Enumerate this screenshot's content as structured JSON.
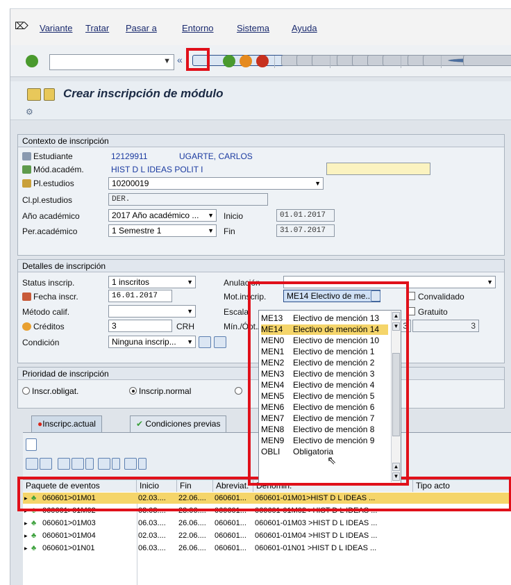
{
  "menu": [
    "Variante",
    "Tratar",
    "Pasar a",
    "Entorno",
    "Sistema",
    "Ayuda"
  ],
  "title": "Crear inscripción de módulo",
  "contexto": {
    "caption": "Contexto de inscripción",
    "estudiante_label": "Estudiante",
    "estudiante_id": "12129911",
    "estudiante_name": "UGARTE, CARLOS",
    "modacadem_label": "Mód.académ.",
    "modacadem_value": "HIST D L IDEAS POLIT I",
    "plestudios_label": "Pl.estudios",
    "plestudios_value": "10200019",
    "clpl_label": "Cl.pl.estudios",
    "clpl_value": "DER.",
    "anio_label": "Año académico",
    "anio_value": "2017 Año académico ...",
    "inicio_label": "Inicio",
    "inicio_value": "01.01.2017",
    "per_label": "Per.académico",
    "per_value": "1 Semestre 1",
    "fin_label": "Fin",
    "fin_value": "31.07.2017"
  },
  "detalles": {
    "caption": "Detalles de inscripción",
    "status_label": "Status inscrip.",
    "status_value": "1 inscritos",
    "anulacion_label": "Anulación",
    "fecha_label": "Fecha inscr.",
    "fecha_value": "16.01.2017",
    "motinscrip_label": "Mot.inscrip.",
    "motinscrip_value": "ME14 Electivo de me...",
    "convalidado_label": "Convalidado",
    "metodo_label": "Método calif.",
    "escala_label": "Escala",
    "gratuito_label": "Gratuito",
    "creditos_label": "Créditos",
    "creditos_value": "3",
    "creditos_unit": "CRH",
    "minopt_label": "Mín./Ópt./Ma",
    "min_value": "3",
    "max_value": "3",
    "condicion_label": "Condición",
    "condicion_value": "Ninguna inscrip..."
  },
  "prioridad": {
    "caption": "Prioridad de inscripción",
    "opt1": "Inscr.obligat.",
    "opt2": "Inscrip.normal"
  },
  "tabs": [
    "Inscripc.actual",
    "Condiciones previas"
  ],
  "dropdown_items": [
    {
      "code": "ME13",
      "text": "Electivo de mención 13",
      "selected": false
    },
    {
      "code": "ME14",
      "text": "Electivo de mención 14",
      "selected": true
    },
    {
      "code": "MEN0",
      "text": "Electivo de mención 10",
      "selected": false
    },
    {
      "code": "MEN1",
      "text": "Electivo de mención 1",
      "selected": false
    },
    {
      "code": "MEN2",
      "text": "Electivo de mención 2",
      "selected": false
    },
    {
      "code": "MEN3",
      "text": "Electivo de mención 3",
      "selected": false
    },
    {
      "code": "MEN4",
      "text": "Electivo de mención 4",
      "selected": false
    },
    {
      "code": "MEN5",
      "text": "Electivo de mención 5",
      "selected": false
    },
    {
      "code": "MEN6",
      "text": "Electivo de mención 6",
      "selected": false
    },
    {
      "code": "MEN7",
      "text": "Electivo de mención 7",
      "selected": false
    },
    {
      "code": "MEN8",
      "text": "Electivo de mención 8",
      "selected": false
    },
    {
      "code": "MEN9",
      "text": "Electivo de mención 9",
      "selected": false
    },
    {
      "code": "OBLI",
      "text": "Obligatoria",
      "selected": false
    }
  ],
  "table": {
    "headers": [
      "Paquete de eventos",
      "Inicio",
      "Fin",
      "Abreviat.",
      "Denomin.",
      "Tipo acto"
    ],
    "rows": [
      {
        "paquete": "060601>01M01",
        "inicio": "02.03....",
        "fin": "22.06....",
        "abrev": "060601...",
        "denom": "060601-01M01>HIST D L IDEAS ...",
        "selected": true
      },
      {
        "paquete": "060601>01M02",
        "inicio": "03.03....",
        "fin": "23.06....",
        "abrev": "060601...",
        "denom": "060601-01M02 >HIST D L IDEAS ...",
        "selected": false
      },
      {
        "paquete": "060601>01M03",
        "inicio": "06.03....",
        "fin": "26.06....",
        "abrev": "060601...",
        "denom": "060601-01M03 >HIST D L IDEAS ...",
        "selected": false
      },
      {
        "paquete": "060601>01M04",
        "inicio": "02.03....",
        "fin": "22.06....",
        "abrev": "060601...",
        "denom": "060601-01M04 >HIST D L IDEAS ...",
        "selected": false
      },
      {
        "paquete": "060601>01N01",
        "inicio": "06.03....",
        "fin": "26.06....",
        "abrev": "060601...",
        "denom": "060601-01N01 >HIST D L IDEAS ...",
        "selected": false
      }
    ]
  }
}
